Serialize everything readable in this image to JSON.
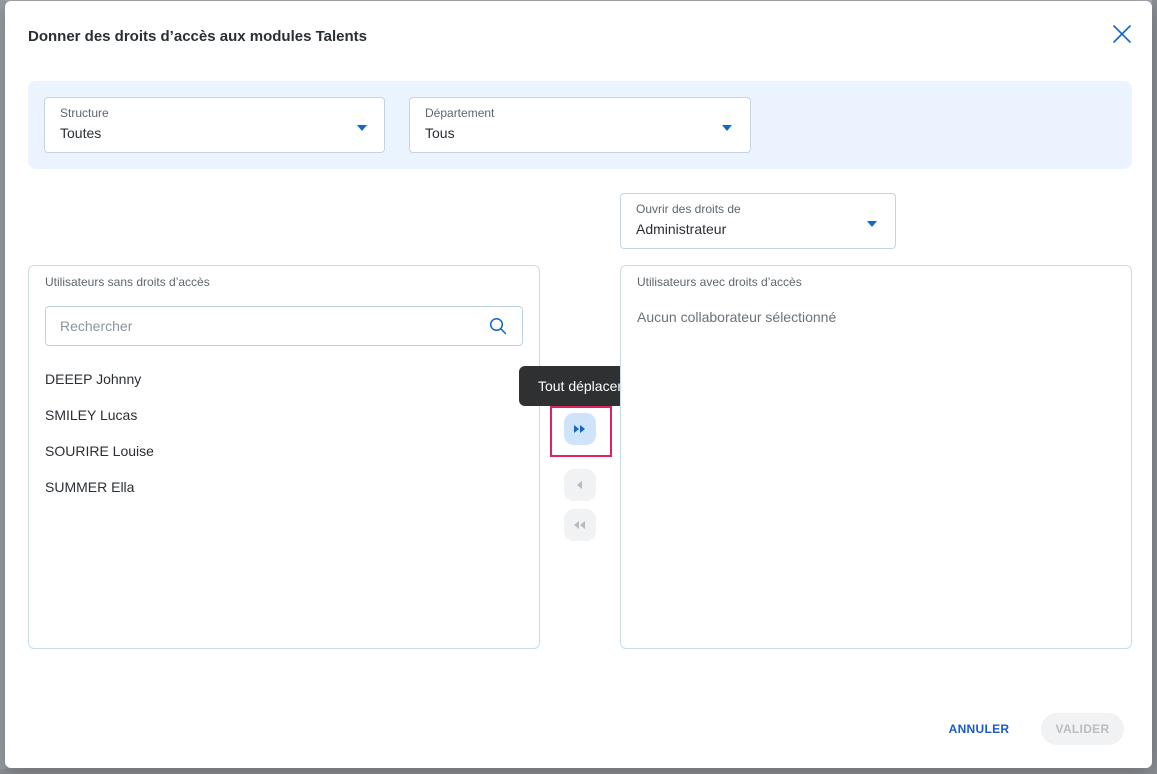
{
  "dialog": {
    "title": "Donner des droits d’accès aux modules Talents"
  },
  "filters": {
    "structure": {
      "label": "Structure",
      "value": "Toutes"
    },
    "department": {
      "label": "Département",
      "value": "Tous"
    }
  },
  "rights": {
    "label": "Ouvrir des droits de",
    "value": "Administrateur"
  },
  "left_panel": {
    "title": "Utilisateurs sans droits d’accès",
    "search_placeholder": "Rechercher",
    "users": [
      "DEEEP Johnny",
      "SMILEY Lucas",
      "SOURIRE Louise",
      "SUMMER Ella"
    ]
  },
  "right_panel": {
    "title": "Utilisateurs avec droits d’accès",
    "empty": "Aucun collaborateur sélectionné"
  },
  "transfer": {
    "tooltip": "Tout déplacer"
  },
  "footer": {
    "cancel": "ANNULER",
    "validate": "VALIDER"
  },
  "colors": {
    "accent": "#1466c8",
    "highlight": "#e0235f",
    "filter_band": "#eaf3fe"
  }
}
